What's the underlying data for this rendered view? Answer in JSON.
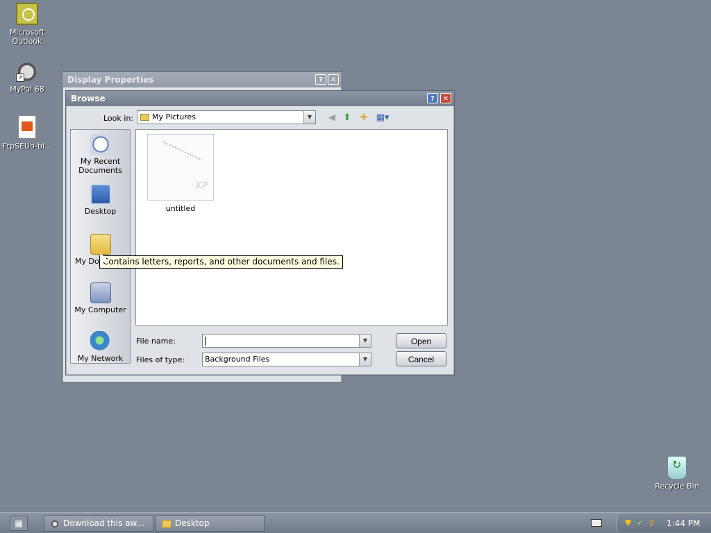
{
  "desktop": {
    "icons": [
      {
        "label": "Microsoft Outlook",
        "icon": "outlook-icon"
      },
      {
        "label": "MyPal 68",
        "icon": "mypal-icon"
      },
      {
        "label": "FtpSEUo-bl...",
        "icon": "file-icon"
      },
      {
        "label": "Recycle Bin",
        "icon": "recycle-bin-icon"
      }
    ]
  },
  "display_properties": {
    "title": "Display Properties"
  },
  "browse": {
    "title": "Browse",
    "look_in_label": "Look in:",
    "look_in_value": "My Pictures",
    "places": [
      {
        "label": "My Recent Documents",
        "icon": "recent-documents-icon"
      },
      {
        "label": "Desktop",
        "icon": "desktop-icon"
      },
      {
        "label": "My Documents",
        "icon": "my-documents-icon"
      },
      {
        "label": "My Computer",
        "icon": "my-computer-icon"
      },
      {
        "label": "My Network",
        "icon": "network-icon"
      }
    ],
    "places_visible": {
      "my_documents": "My Do"
    },
    "files": [
      {
        "name": "untitled",
        "thumb_text": "XP"
      }
    ],
    "file_name_label": "File name:",
    "file_name_value": "",
    "files_of_type_label": "Files of type:",
    "files_of_type_value": "Background Files",
    "open_label": "Open",
    "cancel_label": "Cancel"
  },
  "tooltip": {
    "text": "Contains letters, reports, and other documents and files."
  },
  "taskbar": {
    "tasks": [
      {
        "label": "Download this aw..."
      },
      {
        "label": "Desktop"
      }
    ],
    "clock": "1:44 PM"
  },
  "colors": {
    "desktop": "#7c8594",
    "close": "#c44a3e",
    "help": "#4a76c2",
    "tooltip": "#ffffe1"
  }
}
